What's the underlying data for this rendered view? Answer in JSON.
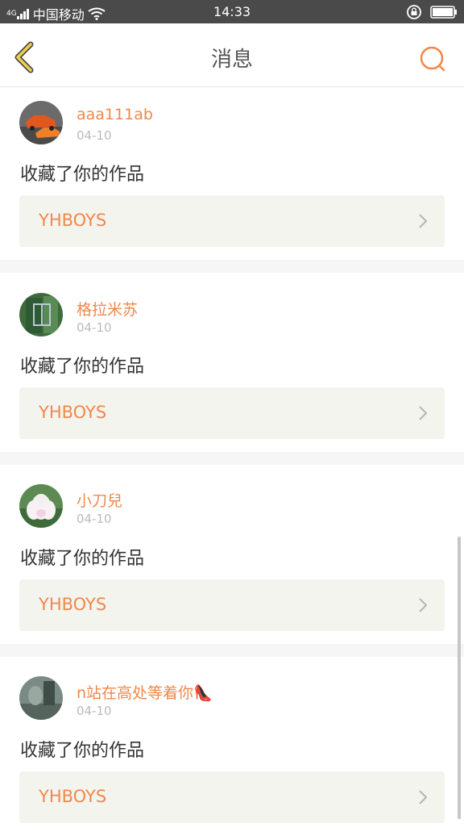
{
  "status_bar": {
    "network": "4G",
    "carrier": "中国移动",
    "time": "14:33"
  },
  "header": {
    "title": "消息",
    "back_icon": "chevron-left-icon",
    "search_icon": "search-icon"
  },
  "accent_color": "#f0884a",
  "messages": [
    {
      "username": "aaa111ab",
      "date": "04-10",
      "action": "收藏了你的作品",
      "work_title": "YHBOYS"
    },
    {
      "username": "格拉米苏",
      "date": "04-10",
      "action": "收藏了你的作品",
      "work_title": "YHBOYS"
    },
    {
      "username": "小刀兒",
      "date": "04-10",
      "action": "收藏了你的作品",
      "work_title": "YHBOYS"
    },
    {
      "username": "n站在高处等着你👠",
      "date": "04-10",
      "action": "收藏了你的作品",
      "work_title": "YHBOYS"
    }
  ]
}
